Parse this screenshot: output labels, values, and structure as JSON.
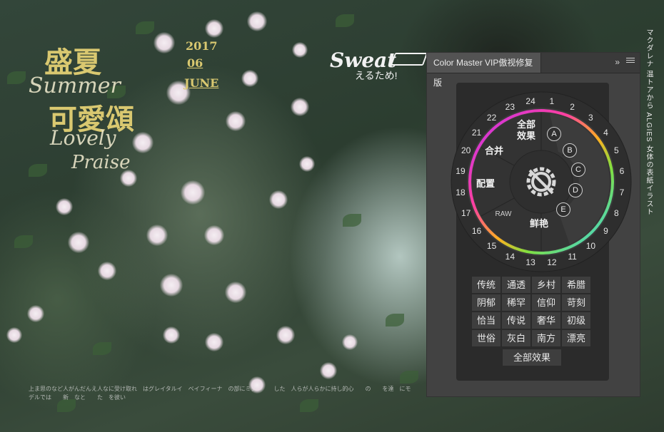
{
  "photo": {
    "title_cjk_top": "盛夏",
    "title_cjk_bottom": "可愛頌",
    "script_summer": "Summer",
    "script_lovely": "Lovely",
    "script_praise": "Praise",
    "year": "2017",
    "month": "06",
    "month_name": "JUNE",
    "sweat": "Sweat",
    "sweat_sub": "えるため!",
    "vertical_text": "マクダレナ 温トアから ALGIES 女体の表紙イラスト",
    "bottom_text": "上ま思のなど人がんだんえ人なに受け取れ　はグレイタルイ　ベイフィーナ　の部にミシ　　　した　人らが人らかに持し的心　　の　　を達　にモデルでは　　新　なと　　た　を彼い"
  },
  "panel": {
    "tab_title": "Color Master VIP傲视修复版",
    "collapse_glyph": "»",
    "wheel": {
      "numbers": [
        "1",
        "2",
        "3",
        "4",
        "5",
        "6",
        "7",
        "8",
        "9",
        "10",
        "11",
        "12",
        "13",
        "14",
        "15",
        "16",
        "17",
        "18",
        "19",
        "20",
        "21",
        "22",
        "23",
        "24"
      ],
      "labels": {
        "all_effects": "全部\n效果",
        "merge": "合并",
        "config": "配置",
        "raw": "RAW",
        "vivid": "鲜艳"
      },
      "letters": [
        "A",
        "B",
        "C",
        "D",
        "E"
      ]
    },
    "presets": [
      "传统",
      "通透",
      "乡村",
      "希腊",
      "阴郁",
      "稀罕",
      "信仰",
      "苛刻",
      "恰当",
      "传说",
      "奢华",
      "初级",
      "世俗",
      "灰白",
      "南方",
      "漂亮"
    ],
    "all_effects_button": "全部效果"
  },
  "colors": {
    "panel_bg": "#424242",
    "panel_inner": "#2b2b2b",
    "tab_bg": "#535353",
    "ring_start": "#c030f0",
    "ring_end": "#30d0ff",
    "title_gold": "#d9c870"
  }
}
